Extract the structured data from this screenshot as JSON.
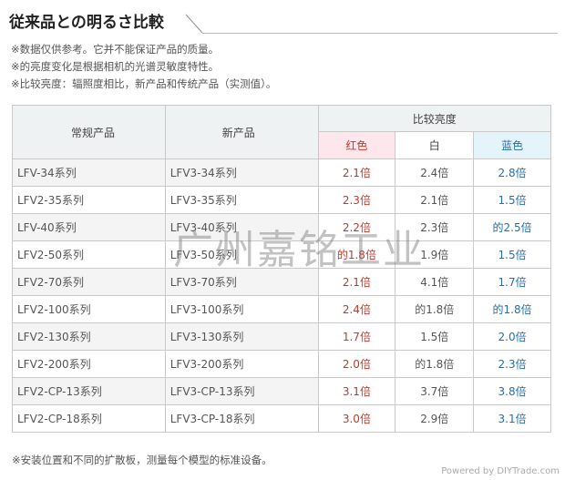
{
  "title": "従来品との明るさ比較",
  "notes": [
    "※数据仅供参考。它并不能保证产品的质量。",
    "※的亮度变化是根据相机的光谱灵敏度特性。",
    "※比较亮度：辐照度相比，新产品和传统产品（实测值）。"
  ],
  "table": {
    "col_old": "常规产品",
    "col_new": "新产品",
    "col_compare": "比较亮度",
    "sub_red": "红色",
    "sub_white": "白",
    "sub_blue": "蓝色",
    "rows": [
      {
        "old": "LFV-34系列",
        "new": "LFV3-34系列",
        "red": "2.1倍",
        "white": "2.4倍",
        "blue": "2.8倍"
      },
      {
        "old": "LFV2-35系列",
        "new": "LFV3-35系列",
        "red": "2.3倍",
        "white": "2.1倍",
        "blue": "1.5倍"
      },
      {
        "old": "LFV-40系列",
        "new": "LFV3-40系列",
        "red": "2.2倍",
        "white": "2.3倍",
        "blue": "的2.5倍"
      },
      {
        "old": "LFV2-50系列",
        "new": "LFV3-50系列",
        "red": "的1.8倍",
        "white": "1.9倍",
        "blue": "1.5倍"
      },
      {
        "old": "LFV2-70系列",
        "new": "LFV3-70系列",
        "red": "2.1倍",
        "white": "4.1倍",
        "blue": "1.7倍"
      },
      {
        "old": "LFV2-100系列",
        "new": "LFV3-100系列",
        "red": "2.4倍",
        "white": "的1.8倍",
        "blue": "的1.8倍"
      },
      {
        "old": "LFV2-130系列",
        "new": "LFV3-130系列",
        "red": "1.7倍",
        "white": "1.5倍",
        "blue": "2.0倍"
      },
      {
        "old": "LFV2-200系列",
        "new": "LFV3-200系列",
        "red": "2.0倍",
        "white": "的1.8倍",
        "blue": "2.3倍"
      },
      {
        "old": "LFV2-CP-13系列",
        "new": "LFV3-CP-13系列",
        "red": "3.1倍",
        "white": "3.7倍",
        "blue": "3.8倍"
      },
      {
        "old": "LFV2-CP-18系列",
        "new": "LFV3-CP-18系列",
        "red": "3.0倍",
        "white": "2.9倍",
        "blue": "3.1倍"
      }
    ]
  },
  "footer": "※安装位置和不同的扩散板，测量每个模型的标准设备。",
  "watermark": "广州嘉铭工业",
  "credit": "Powered by DIYTrade.com",
  "colors": {
    "red_text": "#c0392b",
    "blue_text": "#1f6fb2",
    "red_bg": "#fde7ec",
    "blue_bg": "#e5f3fb",
    "header_bg": "#eff2f2"
  }
}
